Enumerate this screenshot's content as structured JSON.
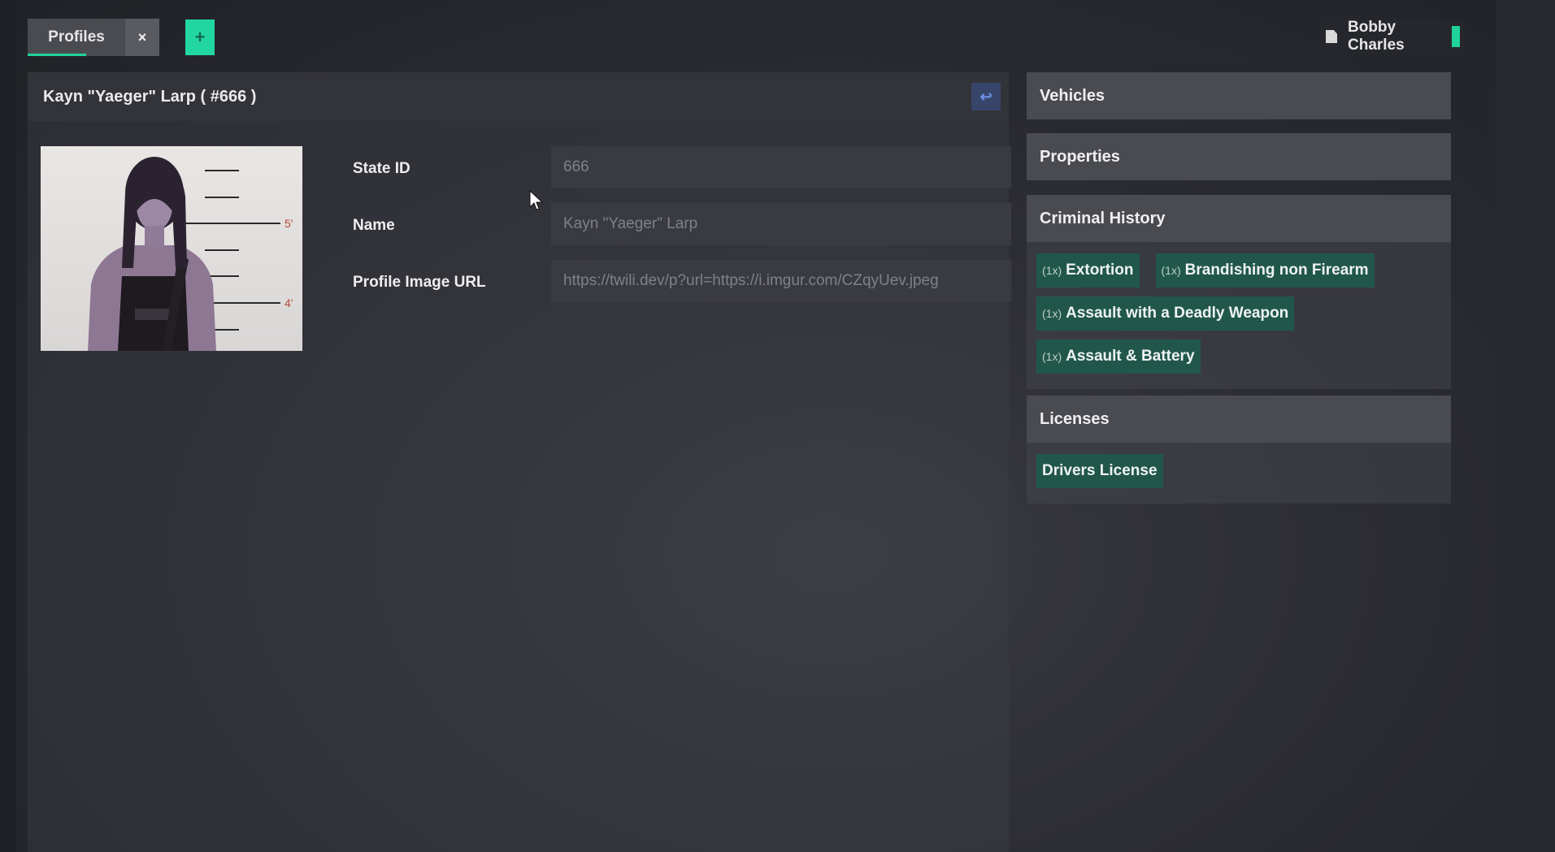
{
  "tabs": {
    "active_label": "Profiles",
    "close_label": "×",
    "add_label": "+"
  },
  "user": {
    "name": "Bobby Charles"
  },
  "profile": {
    "title": "Kayn \"Yaeger\" Larp ( #666 )",
    "back_icon": "↩",
    "fields": [
      {
        "label": "State ID",
        "value": "666"
      },
      {
        "label": "Name",
        "value": "Kayn \"Yaeger\" Larp"
      },
      {
        "label": "Profile Image URL",
        "value": "https://twili.dev/p?url=https://i.imgur.com/CZqyUev.jpeg"
      }
    ],
    "mugshot_marks": [
      "5'",
      "4'"
    ]
  },
  "sidebar": {
    "vehicles": {
      "title": "Vehicles"
    },
    "properties": {
      "title": "Properties"
    },
    "criminal_history": {
      "title": "Criminal History",
      "charges": [
        {
          "count": "(1x)",
          "name": "Extortion"
        },
        {
          "count": "(1x)",
          "name": "Brandishing non Firearm"
        },
        {
          "count": "(1x)",
          "name": "Assault with a Deadly Weapon"
        },
        {
          "count": "(1x)",
          "name": "Assault & Battery"
        }
      ]
    },
    "licenses": {
      "title": "Licenses",
      "items": [
        "Drivers License"
      ]
    }
  },
  "colors": {
    "accent": "#20d39a",
    "tag_bg": "#21574a",
    "back_button": "#38456a"
  }
}
